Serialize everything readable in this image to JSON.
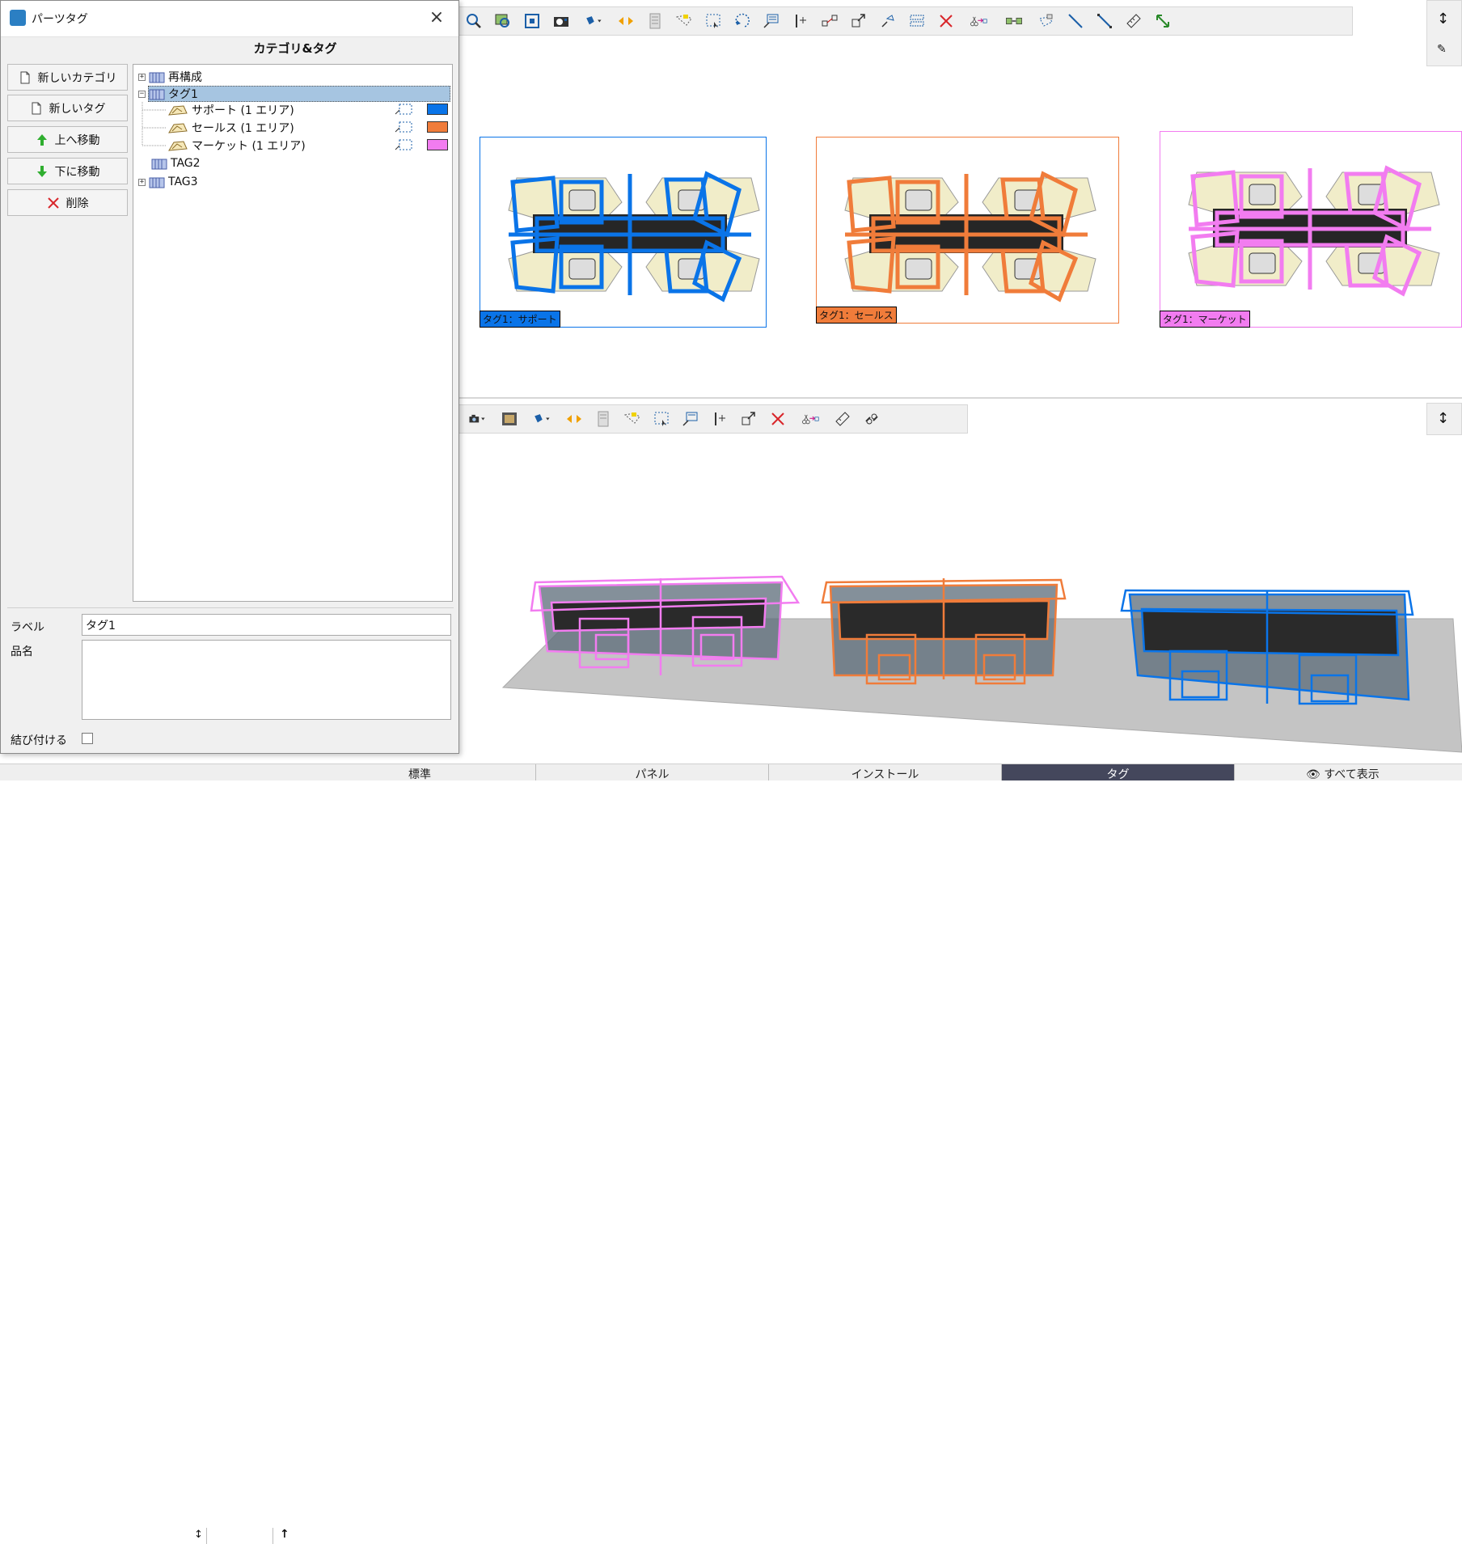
{
  "dialog": {
    "title": "パーツタグ",
    "section_title": "カテゴリ&タグ",
    "buttons": {
      "new_category": "新しいカテゴリ",
      "new_tag": "新しいタグ",
      "move_up": "上へ移動",
      "move_down": "下に移動",
      "delete": "削除"
    },
    "tree": {
      "nodes": [
        {
          "label": "再構成",
          "expanded": false
        },
        {
          "label": "タグ1",
          "expanded": true,
          "selected": true,
          "children": [
            {
              "label": "サポート (1 エリア)",
              "color": "#0a74e8"
            },
            {
              "label": "セールス (1 エリア)",
              "color": "#f07c3a"
            },
            {
              "label": "マーケット (1 エリア)",
              "color": "#f27cf0"
            }
          ]
        },
        {
          "label": "TAG2",
          "expanded": null
        },
        {
          "label": "TAG3",
          "expanded": false
        }
      ]
    },
    "fields": {
      "label_caption": "ラベル",
      "label_value": "タグ1",
      "product_name_caption": "品名",
      "product_name_value": "",
      "bind_caption": "結び付ける",
      "bind_checked": false
    }
  },
  "plan_view": {
    "blocks": [
      {
        "tag": "タグ1：サポート",
        "color": "#0a74e8"
      },
      {
        "tag": "タグ1：セールス",
        "color": "#f07c3a"
      },
      {
        "tag": "タグ1：マーケット",
        "color": "#f27cf0"
      }
    ]
  },
  "tabs": [
    {
      "label": "標準",
      "active": false
    },
    {
      "label": "パネル",
      "active": false
    },
    {
      "label": "インストール",
      "active": false
    },
    {
      "label": "タグ",
      "active": true
    },
    {
      "label": "すべて表示",
      "active": false
    }
  ],
  "icons": {
    "top_toolbar": [
      "zoom-icon",
      "zoom-extents-icon",
      "zoom-window-icon",
      "render-icon",
      "paint-icon",
      "mirror-icon",
      "layers-icon",
      "tag-area-icon",
      "select-icon",
      "rotate-icon",
      "label-icon",
      "dimension-icon",
      "connect-icon",
      "scale-icon",
      "stretch-icon",
      "group-icon",
      "delete-icon",
      "cut-tag-icon",
      "array-icon",
      "freeform-icon",
      "line-icon",
      "measure-line-icon",
      "ruler-icon",
      "resize-icon"
    ],
    "bottom_toolbar": [
      "camera-icon",
      "film-icon",
      "paint-icon",
      "mirror-icon",
      "layers-icon",
      "tag-area-icon",
      "select-icon",
      "label-icon",
      "dimension-icon",
      "scale-icon",
      "delete-icon",
      "cut-tag-icon",
      "ruler-icon",
      "unlink-icon"
    ]
  },
  "colors": {
    "support": "#0a74e8",
    "sales": "#f07c3a",
    "market": "#f27cf0",
    "active_tab": "#44475c",
    "selection": "#a6c5e1"
  }
}
